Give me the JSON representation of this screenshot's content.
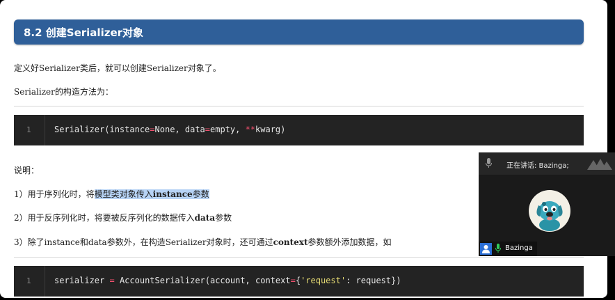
{
  "section": {
    "heading": "8.2 创建Serializer对象"
  },
  "intro": {
    "line1": "定义好Serializer类后，就可以创建Serializer对象了。",
    "line2": "Serializer的构造方法为："
  },
  "code1": {
    "line_number": "1",
    "fn": "Serializer(instance",
    "op1": "=",
    "mid": "None, data",
    "op2": "=",
    "tail1": "empty, ",
    "op3": "**",
    "tail2": "kwarg)"
  },
  "notes": {
    "title": "说明：",
    "item1_pre": "1）用于序列化时，将",
    "item1_hl_a": "模型类对象传入",
    "item1_hl_b": "instance",
    "item1_hl_c": "参数",
    "item2_pre": "2）用于反序列化时，将要被反序列化的数据传入",
    "item2_bold": "data",
    "item2_post": "参数",
    "item3_a": "3）除了instance和data参数外，在构造Serializer对象时，还可通过",
    "item3_bold": "context",
    "item3_b": "参数额外添加数据，如"
  },
  "code2": {
    "line_number": "1",
    "var": "serializer ",
    "eq": "=",
    "call": " AccountSerializer(account, context",
    "eq2": "=",
    "brace_open": "{",
    "key": "'request'",
    "rest": ": request})"
  },
  "video_call": {
    "speaking_label": "正在讲话: Bazinga;",
    "participant_name": "Bazinga",
    "accent_color": "#2b6fd6",
    "icons": [
      "mic-icon",
      "user-icon",
      "mic-active-icon",
      "app-logo-icon"
    ]
  },
  "colors": {
    "heading_bg": "#2f5f99",
    "code_bg": "#232323",
    "highlight": "#b7d3f5",
    "operator": "#f0506e",
    "string": "#e6db74"
  }
}
